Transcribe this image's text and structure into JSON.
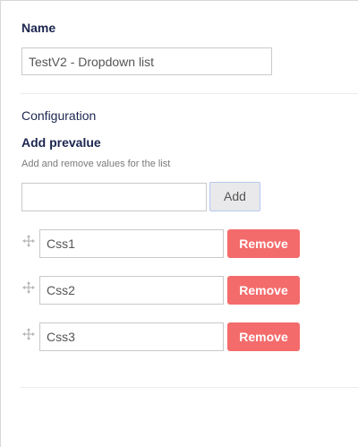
{
  "name_section": {
    "label": "Name",
    "value": "TestV2 - Dropdown list"
  },
  "configuration": {
    "heading": "Configuration",
    "prevalue_label": "Add prevalue",
    "description": "Add and remove values for the list",
    "new_value": "",
    "add_label": "Add",
    "remove_label": "Remove",
    "items": [
      {
        "value": "Css1"
      },
      {
        "value": "Css2"
      },
      {
        "value": "Css3"
      }
    ]
  },
  "colors": {
    "remove_button": "#f46b6b",
    "heading_text": "#1b264f",
    "add_button_border": "#b7c8ef"
  },
  "icons": {
    "drag": "move-handle-icon"
  }
}
